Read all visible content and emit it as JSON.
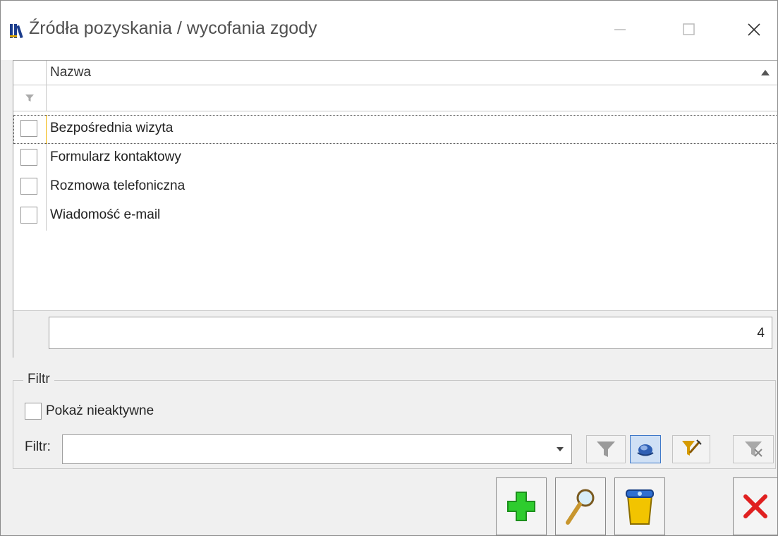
{
  "window": {
    "title": "Źródła pozyskania / wycofania zgody",
    "icons": {
      "app": "books-icon",
      "minimize": "minimize-icon",
      "maximize": "maximize-icon",
      "close": "close-icon"
    }
  },
  "grid": {
    "columns": [
      {
        "label": "Nazwa",
        "sort": "ascending"
      }
    ],
    "rows": [
      {
        "checked": false,
        "name": "Bezpośrednia wizyta",
        "selected": true
      },
      {
        "checked": false,
        "name": "Formularz kontaktowy",
        "selected": false
      },
      {
        "checked": false,
        "name": "Rozmowa telefoniczna",
        "selected": false
      },
      {
        "checked": false,
        "name": "Wiadomość e-mail",
        "selected": false
      }
    ],
    "count": "4"
  },
  "filter": {
    "group_label": "Filtr",
    "show_inactive_label": "Pokaż nieaktywne",
    "show_inactive_checked": false,
    "filter_label": "Filtr:",
    "filter_value": ""
  },
  "colors": {
    "selection_border": "#f2b400",
    "add": "#2ecc2e",
    "delete": "#e02020"
  }
}
